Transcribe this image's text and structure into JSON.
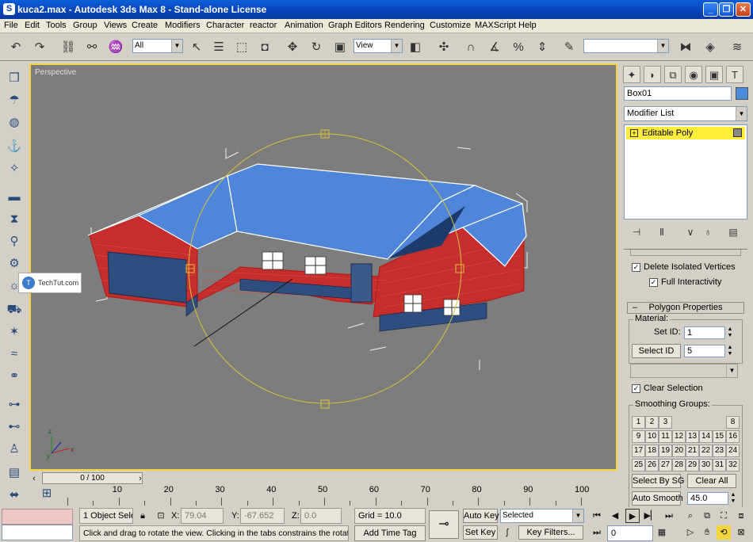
{
  "window": {
    "title": "kuca2.max - Autodesk 3ds Max 8  - Stand-alone License"
  },
  "menu": [
    "File",
    "Edit",
    "Tools",
    "Group",
    "Views",
    "Create",
    "Modifiers",
    "Character",
    "reactor",
    "Animation",
    "Graph Editors",
    "Rendering",
    "Customize",
    "MAXScript",
    "Help"
  ],
  "toolbar": {
    "selection_filter": "All",
    "ref_coord": "View",
    "named_sel": ""
  },
  "viewport": {
    "label": "Perspective",
    "watermark": "TechTut.com"
  },
  "command_panel": {
    "object_name": "Box01",
    "object_color": "#4a8bdb",
    "modifier_list": "Modifier List",
    "stack_item": "Editable Poly",
    "delete_isolated": "Delete Isolated Vertices",
    "full_interactivity": "Full Interactivity",
    "polygon_properties": "Polygon Properties",
    "material_group": "Material:",
    "set_id_label": "Set ID:",
    "set_id_value": "1",
    "select_id_label": "Select ID",
    "select_id_value": "5",
    "clear_selection": "Clear Selection",
    "smoothing_groups": "Smoothing Groups:",
    "smoothing_numbers": [
      "1",
      "2",
      "3",
      "",
      "",
      "",
      "",
      "8",
      "9",
      "10",
      "11",
      "12",
      "13",
      "14",
      "15",
      "16",
      "17",
      "18",
      "19",
      "20",
      "21",
      "22",
      "23",
      "24",
      "25",
      "26",
      "27",
      "28",
      "29",
      "30",
      "31",
      "32"
    ],
    "select_by_sg": "Select By SG",
    "clear_all": "Clear All",
    "auto_smooth": "Auto Smooth",
    "auto_smooth_value": "45.0"
  },
  "timeline": {
    "slider": "0 / 100",
    "ticks": [
      "10",
      "20",
      "30",
      "40",
      "50",
      "60",
      "70",
      "80",
      "90",
      "100"
    ]
  },
  "status": {
    "selection": "1 Object Sele",
    "x_label": "X:",
    "x": "79.04",
    "y_label": "Y:",
    "y": "-67.652",
    "z_label": "Z:",
    "z": "0.0",
    "grid": "Grid = 10.0",
    "prompt": "Click and drag to rotate the view.  Clicking in the tabs constrains the rotation",
    "add_time_tag": "Add Time Tag",
    "auto_key": "Auto Key",
    "set_key": "Set Key",
    "key_mode": "Selected",
    "key_filters": "Key Filters...",
    "frame": "0"
  }
}
